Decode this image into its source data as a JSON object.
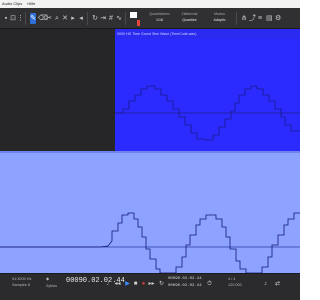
{
  "menubar": {
    "items": [
      "Audio Clips",
      "Hilfe"
    ]
  },
  "toolbar": {
    "field1": {
      "label": "Quantisieren",
      "value": "1/16"
    },
    "field2": {
      "label": "Zielformat",
      "value": "Quantize"
    },
    "field3": {
      "label": "Modus",
      "value": "Adaptiv"
    },
    "swatch_colors": [
      "#ffffff",
      "#e0473a"
    ],
    "accent": "#2f6fd8"
  },
  "editor": {
    "clip_name": "0000 HD Time Grund Sine Wave (TimeCode.wav)",
    "clip_color": "#2b2bff"
  },
  "lower_panel": {
    "color": "#8ea2ff"
  },
  "transport": {
    "left_top": "91:3200 Hz",
    "left_bottom": "Samples 8",
    "position_label": "Zyklus",
    "main_time": "00090.02.02.44",
    "secondary_time": "00090.02.02.44",
    "secondary_time_2": "00090.02.02.44",
    "right_label": "4 / 4",
    "right_bottom": "120.000"
  }
}
